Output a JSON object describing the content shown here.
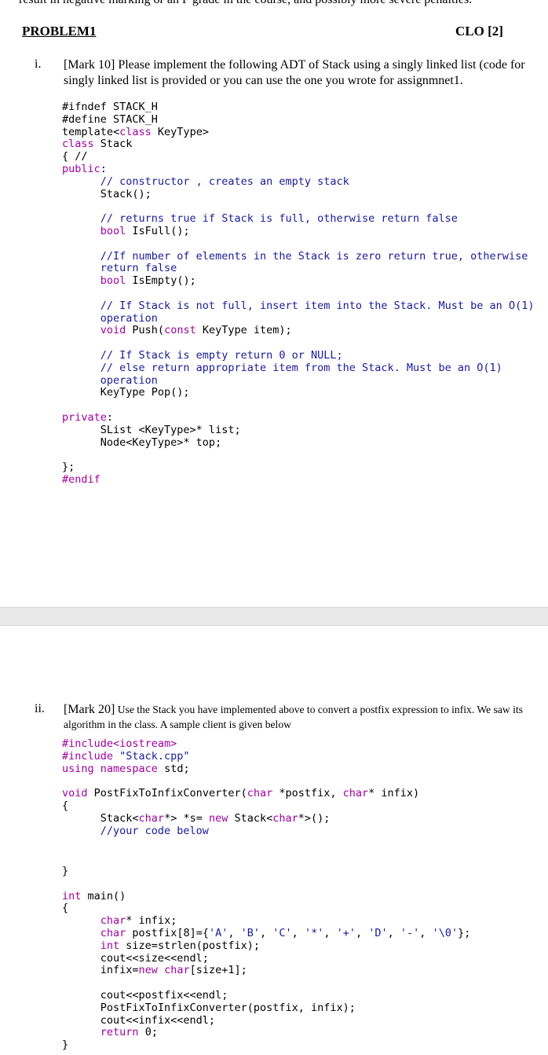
{
  "page1": {
    "cut_text": "result in negative marking or an F grade in the course, and possibly more severe penalties.",
    "problem_title": "PROBLEM1",
    "clo": "CLO [2]",
    "q1": {
      "number": "i.",
      "line1": "[Mark 10] Please implement the following ADT of Stack using a singly linked list (code for",
      "line2": "singly linked list is provided or you can use the one you wrote for assignmnet1."
    },
    "code1": [
      [
        [
          "#ifndef STACK_H",
          "t"
        ]
      ],
      [
        [
          "#define STACK_H",
          "t"
        ]
      ],
      [
        [
          "template<",
          "t"
        ],
        [
          "class",
          "k"
        ],
        [
          " KeyType>",
          "t"
        ]
      ],
      [
        [
          "class",
          "k"
        ],
        [
          " Stack",
          "t"
        ]
      ],
      [
        [
          "{ //",
          "t"
        ]
      ],
      [
        [
          "public",
          "k"
        ],
        [
          ":",
          "t"
        ]
      ],
      [
        [
          "      // constructor , creates an empty stack",
          "c"
        ]
      ],
      [
        [
          "      Stack();",
          "t"
        ]
      ],
      [
        [
          "",
          "t"
        ]
      ],
      [
        [
          "      // returns true if Stack is full, otherwise return false",
          "c"
        ]
      ],
      [
        [
          "      ",
          "t"
        ],
        [
          "bool",
          "k"
        ],
        [
          " IsFull();",
          "t"
        ]
      ],
      [
        [
          "",
          "t"
        ]
      ],
      [
        [
          "      //If number of elements in the Stack is zero return true, otherwise",
          "c"
        ]
      ],
      [
        [
          "      return false",
          "c"
        ]
      ],
      [
        [
          "      ",
          "t"
        ],
        [
          "bool",
          "k"
        ],
        [
          " IsEmpty();",
          "t"
        ]
      ],
      [
        [
          "",
          "t"
        ]
      ],
      [
        [
          "      // If Stack is not full, insert item into the Stack. Must be an O(1)",
          "c"
        ]
      ],
      [
        [
          "      operation",
          "c"
        ]
      ],
      [
        [
          "      ",
          "t"
        ],
        [
          "void",
          "k"
        ],
        [
          " Push(",
          "t"
        ],
        [
          "const",
          "k"
        ],
        [
          " KeyType item);",
          "t"
        ]
      ],
      [
        [
          "",
          "t"
        ]
      ],
      [
        [
          "      // If Stack is empty return 0 or NULL;",
          "c"
        ]
      ],
      [
        [
          "      // else return appropriate item from the Stack. Must be an O(1)",
          "c"
        ]
      ],
      [
        [
          "      operation",
          "c"
        ]
      ],
      [
        [
          "      KeyType Pop();",
          "t"
        ]
      ],
      [
        [
          "",
          "t"
        ]
      ],
      [
        [
          "private",
          "k"
        ],
        [
          ":",
          "t"
        ]
      ],
      [
        [
          "      SList <KeyType>* list;",
          "t"
        ]
      ],
      [
        [
          "      Node<KeyType>* top;",
          "t"
        ]
      ],
      [
        [
          "",
          "t"
        ]
      ],
      [
        [
          "};",
          "t"
        ]
      ],
      [
        [
          "#endif",
          "k"
        ]
      ]
    ]
  },
  "page2": {
    "q2": {
      "number": "ii.",
      "mark": "[Mark 20]",
      "line1_rest": " Use the Stack you have implemented above to convert a postfix expression to infix. We saw its",
      "line2": "algorithm in the class. A sample client is given below"
    },
    "code2a": [
      [
        [
          "#include<iostream>",
          "k"
        ]
      ],
      [
        [
          "#include ",
          "k"
        ],
        [
          "\"Stack.cpp\"",
          "s"
        ]
      ],
      [
        [
          "using",
          "k"
        ],
        [
          " ",
          "t"
        ],
        [
          "namespace",
          "k"
        ],
        [
          " std;",
          "t"
        ]
      ],
      [
        [
          "",
          "t"
        ]
      ],
      [
        [
          "void",
          "k"
        ],
        [
          " PostFixToInfixConverter(",
          "t"
        ],
        [
          "char",
          "k"
        ],
        [
          " *postfix, ",
          "t"
        ],
        [
          "char",
          "k"
        ],
        [
          "* infix)",
          "t"
        ]
      ],
      [
        [
          "{",
          "t"
        ]
      ],
      [
        [
          "      Stack<",
          "t"
        ],
        [
          "char",
          "k"
        ],
        [
          "*> *s= ",
          "t"
        ],
        [
          "new",
          "k"
        ],
        [
          " Stack<",
          "t"
        ],
        [
          "char",
          "k"
        ],
        [
          "*>();",
          "t"
        ]
      ],
      [
        [
          "      //your code below",
          "c"
        ]
      ]
    ],
    "code2b": [
      [
        [
          "}",
          "t"
        ]
      ],
      [
        [
          "",
          "t"
        ]
      ],
      [
        [
          "int",
          "k"
        ],
        [
          " main()",
          "t"
        ]
      ],
      [
        [
          "{",
          "t"
        ]
      ],
      [
        [
          "      ",
          "t"
        ],
        [
          "char",
          "k"
        ],
        [
          "* infix;",
          "t"
        ]
      ],
      [
        [
          "      ",
          "t"
        ],
        [
          "char",
          "k"
        ],
        [
          " postfix[8]={",
          "t"
        ],
        [
          "'A'",
          "s"
        ],
        [
          ", ",
          "t"
        ],
        [
          "'B'",
          "s"
        ],
        [
          ", ",
          "t"
        ],
        [
          "'C'",
          "s"
        ],
        [
          ", ",
          "t"
        ],
        [
          "'*'",
          "s"
        ],
        [
          ", ",
          "t"
        ],
        [
          "'+'",
          "s"
        ],
        [
          ", ",
          "t"
        ],
        [
          "'D'",
          "s"
        ],
        [
          ", ",
          "t"
        ],
        [
          "'-'",
          "s"
        ],
        [
          ", ",
          "t"
        ],
        [
          "'\\0'",
          "s"
        ],
        [
          "};",
          "t"
        ]
      ],
      [
        [
          "      ",
          "t"
        ],
        [
          "int",
          "k"
        ],
        [
          " size=strlen(postfix);",
          "t"
        ]
      ],
      [
        [
          "      cout<<size<<endl;",
          "t"
        ]
      ],
      [
        [
          "      infix=",
          "t"
        ],
        [
          "new",
          "k"
        ],
        [
          " ",
          "t"
        ],
        [
          "char",
          "k"
        ],
        [
          "[size+1];",
          "t"
        ]
      ],
      [
        [
          "",
          "t"
        ]
      ],
      [
        [
          "      cout<<postfix<<endl;",
          "t"
        ]
      ],
      [
        [
          "      PostFixToInfixConverter(postfix, infix);",
          "t"
        ]
      ],
      [
        [
          "      cout<<infix<<endl;",
          "t"
        ]
      ],
      [
        [
          "      ",
          "t"
        ],
        [
          "return",
          "k"
        ],
        [
          " 0;",
          "t"
        ]
      ],
      [
        [
          "}",
          "t"
        ]
      ]
    ]
  }
}
